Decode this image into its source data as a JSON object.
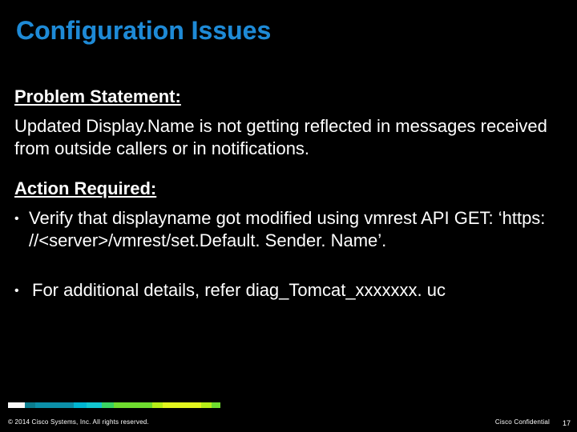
{
  "title": "Configuration Issues",
  "sections": {
    "problem_heading": "Problem Statement:",
    "problem_body": "Updated Display.Name is not getting reflected in messages received from outside callers or in notifications.",
    "action_heading": "Action Required:",
    "bullets": [
      "Verify that displayname got modified using vmrest API GET: ‘https: //<server>/vmrest/set.Default. Sender. Name’.",
      "For additional details, refer  diag_Tomcat_xxxxxxx. uc"
    ]
  },
  "footer": {
    "left": "© 2014 Cisco Systems, Inc. All rights reserved.",
    "right": "Cisco Confidential",
    "page": "17"
  }
}
